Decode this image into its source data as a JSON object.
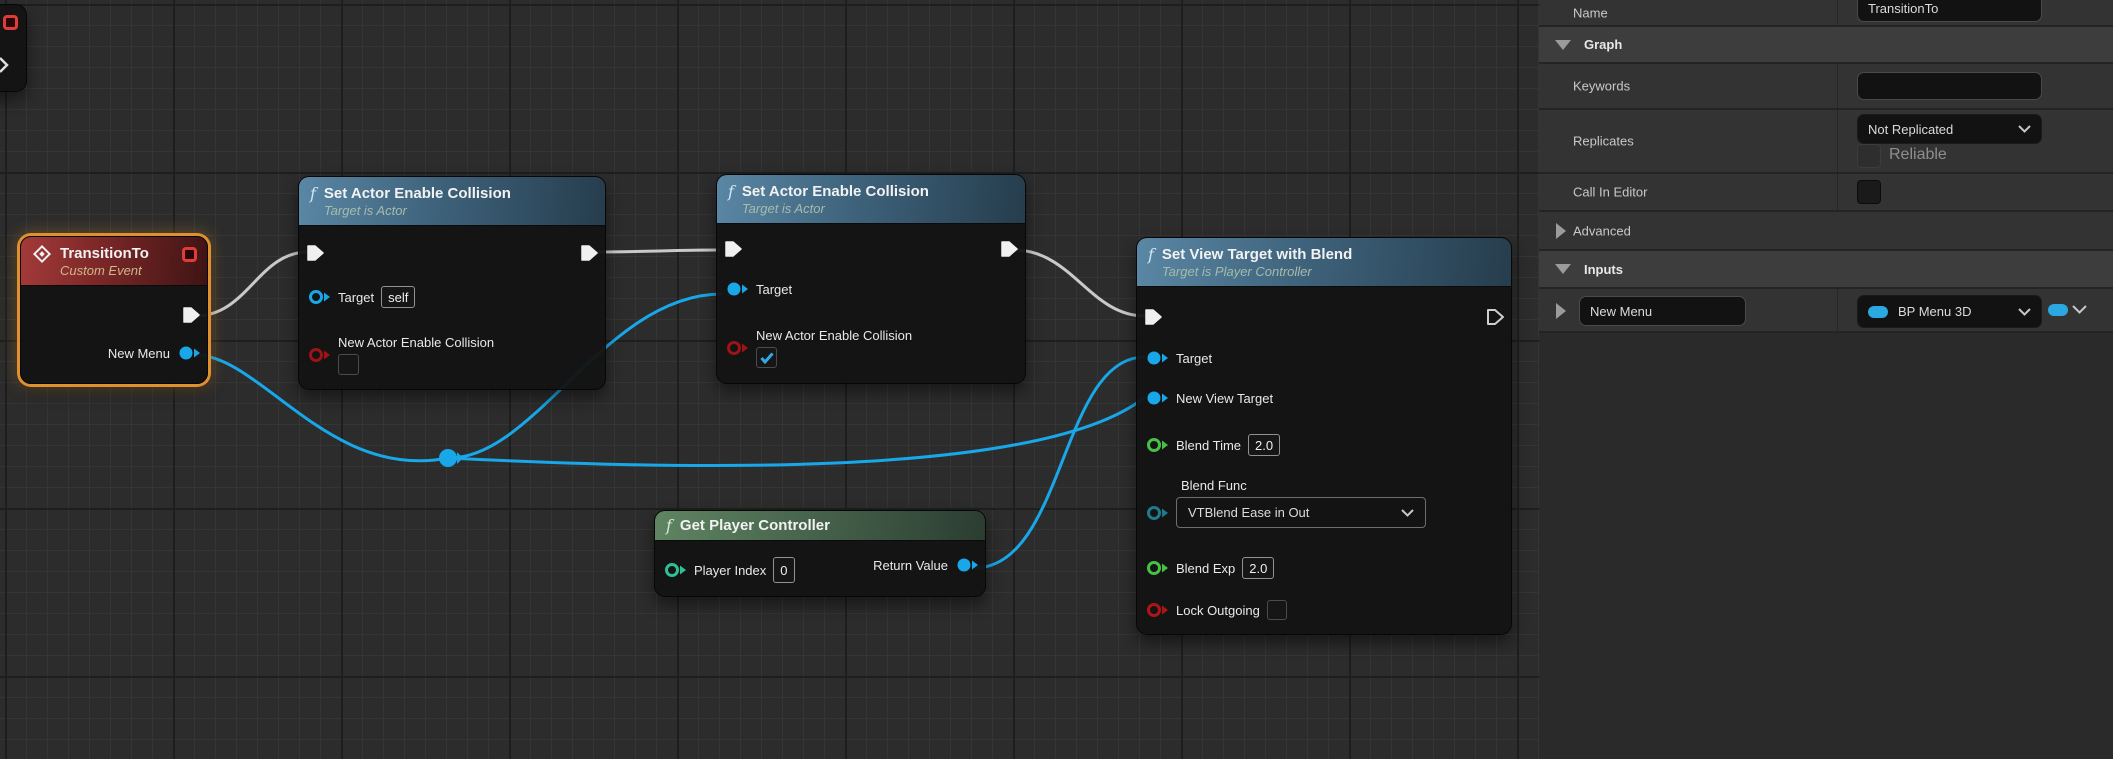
{
  "graph": {
    "transition_to": {
      "title": "TransitionTo",
      "subtitle": "Custom Event",
      "new_menu_pin": "New Menu"
    },
    "set_collision_1": {
      "title": "Set Actor Enable Collision",
      "subtitle": "Target is Actor",
      "target_pin": "Target",
      "target_value": "self",
      "collision_pin": "New Actor Enable Collision"
    },
    "set_collision_2": {
      "title": "Set Actor Enable Collision",
      "subtitle": "Target is Actor",
      "target_pin": "Target",
      "collision_pin": "New Actor Enable Collision"
    },
    "get_player_controller": {
      "title": "Get Player Controller",
      "player_index_pin": "Player Index",
      "player_index_value": "0",
      "return_value_pin": "Return Value"
    },
    "set_view_target": {
      "title": "Set View Target with Blend",
      "subtitle": "Target is Player Controller",
      "target_pin": "Target",
      "new_view_target_pin": "New View Target",
      "blend_time_pin": "Blend Time",
      "blend_time_value": "2.0",
      "blend_func_pin": "Blend Func",
      "blend_func_value": "VTBlend Ease in Out",
      "blend_exp_pin": "Blend Exp",
      "blend_exp_value": "2.0",
      "lock_outgoing_pin": "Lock Outgoing"
    }
  },
  "details_panel": {
    "name_label": "Name",
    "name_value": "TransitionTo",
    "graph_section": "Graph",
    "keywords_label": "Keywords",
    "keywords_value": "",
    "replicates_label": "Replicates",
    "replicates_value": "Not Replicated",
    "reliable_label": "Reliable",
    "call_in_editor_label": "Call In Editor",
    "advanced_section": "Advanced",
    "inputs_section": "Inputs",
    "input_name_value": "New Menu",
    "input_type_value": "BP Menu 3D"
  },
  "colors": {
    "selection_accent": "#e0912f",
    "exec_wire": "#c9c9c9",
    "object_wire": "#18a7e8",
    "object_pin": "#18a7e8",
    "bool_pin": "#9e1315",
    "float_pin": "#46c146",
    "int_pin": "#2fbf95",
    "enum_pin": "#1f7a8c",
    "event_header_red": "#a43a3a",
    "function_header_blue": "#5a87a5",
    "pure_function_header_green": "#5f8562",
    "panel_accent_blue": "#29a9e0"
  }
}
